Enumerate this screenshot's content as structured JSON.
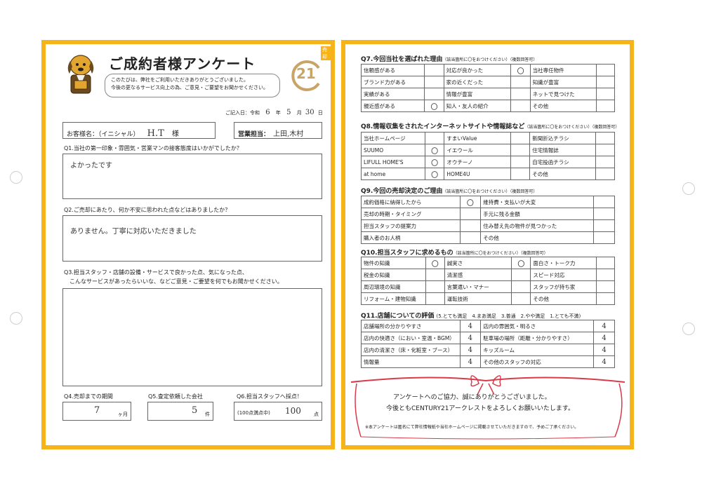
{
  "header": {
    "title": "ご成約者様アンケート",
    "tag": "売却",
    "greeting_line1": "このたびは、弊社をご利用いただきありがとうございました。",
    "greeting_line2": "今後の更なるサービス向上の為、ご意見・ご要望をお聞かせください。",
    "date_label": "ご記入日：令和",
    "date_year": "6",
    "year_unit": "年",
    "date_month": "5",
    "month_unit": "月",
    "date_day": "30",
    "day_unit": "日",
    "brand_number": "21"
  },
  "customer": {
    "name_label": "お客様名：（イニシャル）",
    "name_value": "H.T",
    "honorific": "様",
    "staff_label": "営業担当：",
    "staff_value": "上田,木村"
  },
  "q1": {
    "question": "Q1.当社の第一印象・雰囲気・営業マンの接客態度はいかがでしたか？",
    "answer": "よかったです"
  },
  "q2": {
    "question": "Q2.ご売却にあたり、何か不安に思われた点などはありましたか？",
    "answer": "ありません。丁寧に対応いただきました"
  },
  "q3": {
    "question_line1": "Q3.担当スタッフ・店舗の設備・サービスで良かった点、気になった点、",
    "question_line2": "　こんなサービスがあったらいいな、などご意見・ご要望を何でもお聞かせください。",
    "answer": ""
  },
  "q4": {
    "label": "Q4.売却までの期間",
    "value": "7",
    "unit": "ヶ月"
  },
  "q5": {
    "label": "Q5.査定依頼した会社",
    "value": "5",
    "unit": "件"
  },
  "q6": {
    "label": "Q6.担当スタッフへ採点！",
    "prefix": "(100点満点中)",
    "value": "100",
    "unit": "点"
  },
  "q7": {
    "title": "Q7.今回当社を選ばれた理由",
    "note": "（該当箇所に〇をおつけください）（複数回答可）",
    "rows": [
      [
        "信頼感がある",
        "",
        "対応が良かった",
        "〇",
        "当社専任物件",
        ""
      ],
      [
        "ブランド力がある",
        "",
        "家の近くだった",
        "",
        "知識が豊富",
        ""
      ],
      [
        "実績がある",
        "",
        "情報が豊富",
        "",
        "ネットで見つけた",
        ""
      ],
      [
        "親近感がある",
        "〇",
        "知人・友人の紹介",
        "",
        "その他",
        ""
      ]
    ]
  },
  "q8": {
    "title": "Q8.情報収集をされたインターネットサイトや情報誌など",
    "note": "（該当箇所に〇をおつけください）（複数回答可）",
    "rows": [
      [
        "当社ホームページ",
        "",
        "すまいValue",
        "",
        "新聞折込チラシ",
        ""
      ],
      [
        "SUUMO",
        "〇",
        "イエウール",
        "",
        "住宅情報誌",
        ""
      ],
      [
        "LIFULL HOME'S",
        "〇",
        "オウチーノ",
        "",
        "自宅投函チラシ",
        ""
      ],
      [
        "at home",
        "〇",
        "HOME4U",
        "",
        "その他",
        ""
      ]
    ]
  },
  "q9": {
    "title": "Q9.今回の売却決定のご理由",
    "note": "（該当箇所に〇をおつけください）（複数回答可）",
    "rows": [
      [
        "成約価格に納得したから",
        "〇",
        "維持費・支払いが大変",
        ""
      ],
      [
        "売却の時期・タイミング",
        "",
        "手元に残る金額",
        ""
      ],
      [
        "担当スタッフの提案力",
        "",
        "住み替え先の物件が見つかった",
        ""
      ],
      [
        "購入者のお人柄",
        "",
        "その他",
        ""
      ]
    ]
  },
  "q10": {
    "title": "Q10.担当スタッフに求めるもの",
    "note": "（該当箇所に〇をおつけください）（複数回答可）",
    "rows": [
      [
        "物件の知識",
        "〇",
        "誠実さ",
        "〇",
        "面白さ・トーク力",
        ""
      ],
      [
        "税金の知識",
        "",
        "清潔感",
        "",
        "スピード対応",
        ""
      ],
      [
        "周辺環境の知識",
        "",
        "言葉遣い・マナー",
        "",
        "スタッフが持ち家",
        ""
      ],
      [
        "リフォーム・建物知識",
        "",
        "運転技術",
        "",
        "その他",
        ""
      ]
    ]
  },
  "q11": {
    "title": "Q11.店舗についての評価",
    "scale": "(5.とても満足　4.まあ満足　3.普通　2.やや満足　1.とても不満)",
    "rows": [
      [
        "店舗場所の分かりやすさ",
        "4",
        "店内の雰囲気・明るさ",
        "4"
      ],
      [
        "店内の快適さ（におい・室温・BGM）",
        "4",
        "駐車場の場所（距離・分かりやすさ）",
        "4"
      ],
      [
        "店内の清潔さ（床・化粧室・ブース）",
        "4",
        "キッズルーム",
        "4"
      ],
      [
        "情報量",
        "4",
        "その他のスタッフの対応",
        "4"
      ]
    ]
  },
  "thanks": {
    "line1": "アンケートへのご協力、誠にありがとうございました。",
    "line2": "今後ともCENTURY21アークレストをよろしくお願いいたします。",
    "note": "※本アンケートは匿名にて弊社情報紙や当社ホームページに掲載させていただきますので、予めご了承ください。"
  }
}
